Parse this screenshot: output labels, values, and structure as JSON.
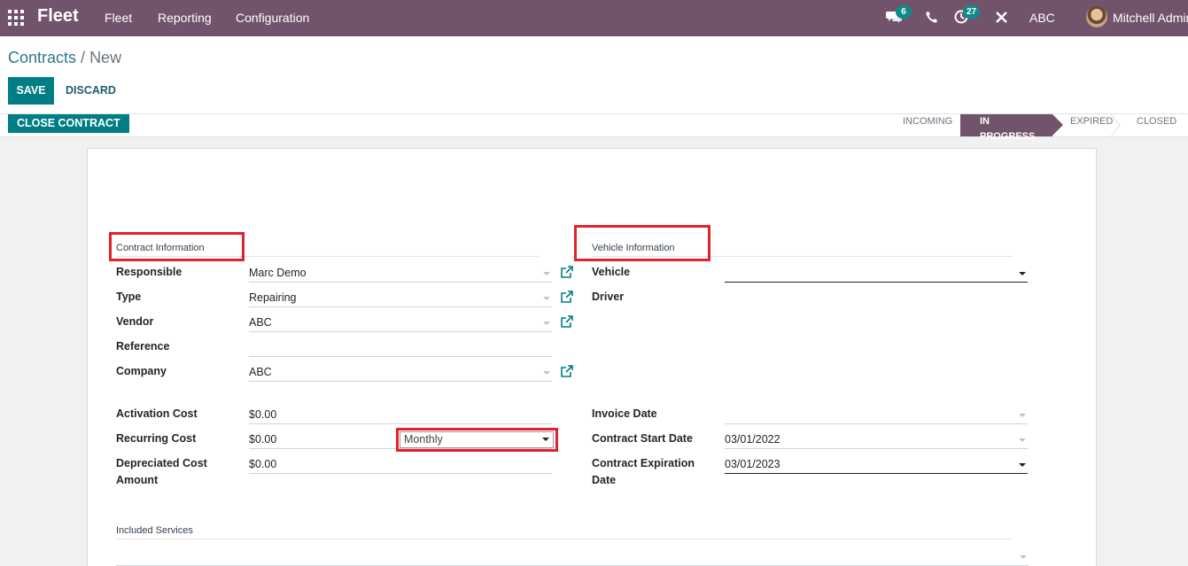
{
  "topbar": {
    "app_name": "Fleet",
    "menus": [
      "Fleet",
      "Reporting",
      "Configuration"
    ],
    "messages_count": "6",
    "activities_count": "27",
    "company": "ABC",
    "user": "Mitchell Admin",
    "accent_color": "#71546b"
  },
  "breadcrumb": {
    "parent": "Contracts",
    "current": "New"
  },
  "actions": {
    "save": "SAVE",
    "discard": "DISCARD",
    "close_contract": "CLOSE CONTRACT"
  },
  "stages": [
    "INCOMING",
    "IN PROGRESS",
    "EXPIRED",
    "CLOSED"
  ],
  "active_stage": "IN PROGRESS",
  "contract_info": {
    "title": "Contract Information",
    "responsible_label": "Responsible",
    "responsible": "Marc Demo",
    "type_label": "Type",
    "type": "Repairing",
    "vendor_label": "Vendor",
    "vendor": "ABC",
    "reference_label": "Reference",
    "reference": "",
    "company_label": "Company",
    "company": "ABC"
  },
  "vehicle_info": {
    "title": "Vehicle Information",
    "vehicle_label": "Vehicle",
    "vehicle": "",
    "driver_label": "Driver"
  },
  "costs": {
    "activation_label": "Activation Cost",
    "activation": "$0.00",
    "recurring_label": "Recurring Cost",
    "recurring": "$0.00",
    "recurring_period": "Monthly",
    "depreciated_label_1": "Depreciated Cost",
    "depreciated_label_2": "Amount",
    "depreciated": "$0.00"
  },
  "dates": {
    "invoice_label": "Invoice Date",
    "invoice": "",
    "start_label": "Contract Start Date",
    "start": "03/01/2022",
    "expiration_label_1": "Contract Expiration",
    "expiration_label_2": "Date",
    "expiration": "03/01/2023"
  },
  "services": {
    "title": "Included Services"
  }
}
